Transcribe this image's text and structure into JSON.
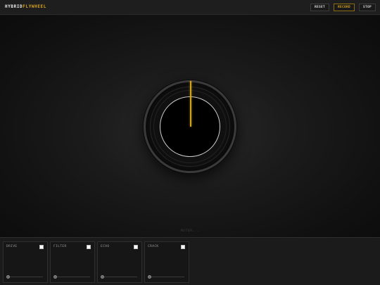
{
  "header": {
    "brand_part1": "HYBRID",
    "brand_part2": "FLYWHEEL",
    "buttons": {
      "reset": "RESET",
      "record": "RECORD",
      "stop": "STOP"
    }
  },
  "stage": {
    "status_text": "MOTOR..."
  },
  "modules": [
    {
      "name": "DRIVE",
      "enabled": true,
      "level": 0.0
    },
    {
      "name": "FILTER",
      "enabled": true,
      "level": 0.0
    },
    {
      "name": "ECHO",
      "enabled": true,
      "level": 0.0
    },
    {
      "name": "CRACK",
      "enabled": true,
      "level": 0.0
    }
  ],
  "colors": {
    "accent": "#d4a21c",
    "background": "#121212"
  }
}
